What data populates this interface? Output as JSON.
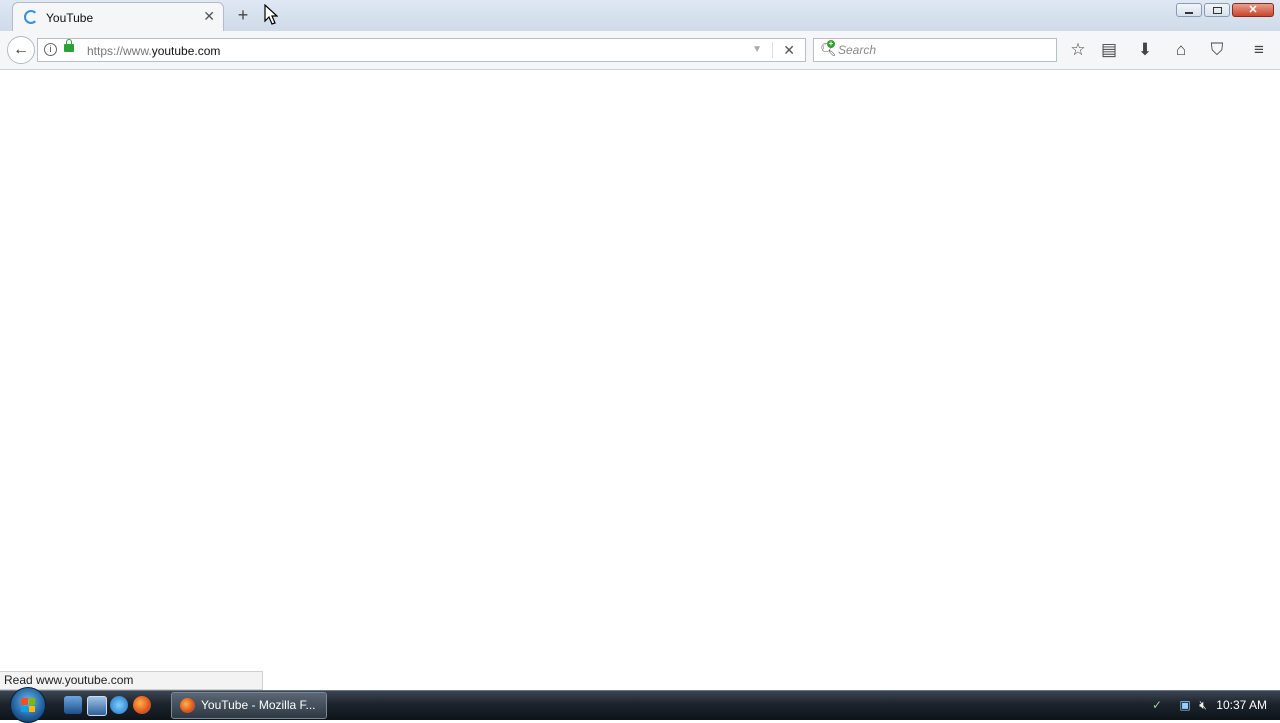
{
  "browser": {
    "tab": {
      "title": "YouTube",
      "close_icon": "close-icon"
    },
    "new_tab_glyph": "+",
    "url": {
      "scheme_www": "https://www.",
      "host": "youtube.com",
      "full": "https://www.youtube.com"
    },
    "search": {
      "placeholder": "Search"
    },
    "status_text": "Read www.youtube.com"
  },
  "taskbar": {
    "window_button_label": "YouTube - Mozilla F...",
    "clock": "10:37 AM"
  },
  "colors": {
    "accent_spinner": "#3a8ee6",
    "lock_green": "#2aa336",
    "close_red": "#c9452c"
  }
}
